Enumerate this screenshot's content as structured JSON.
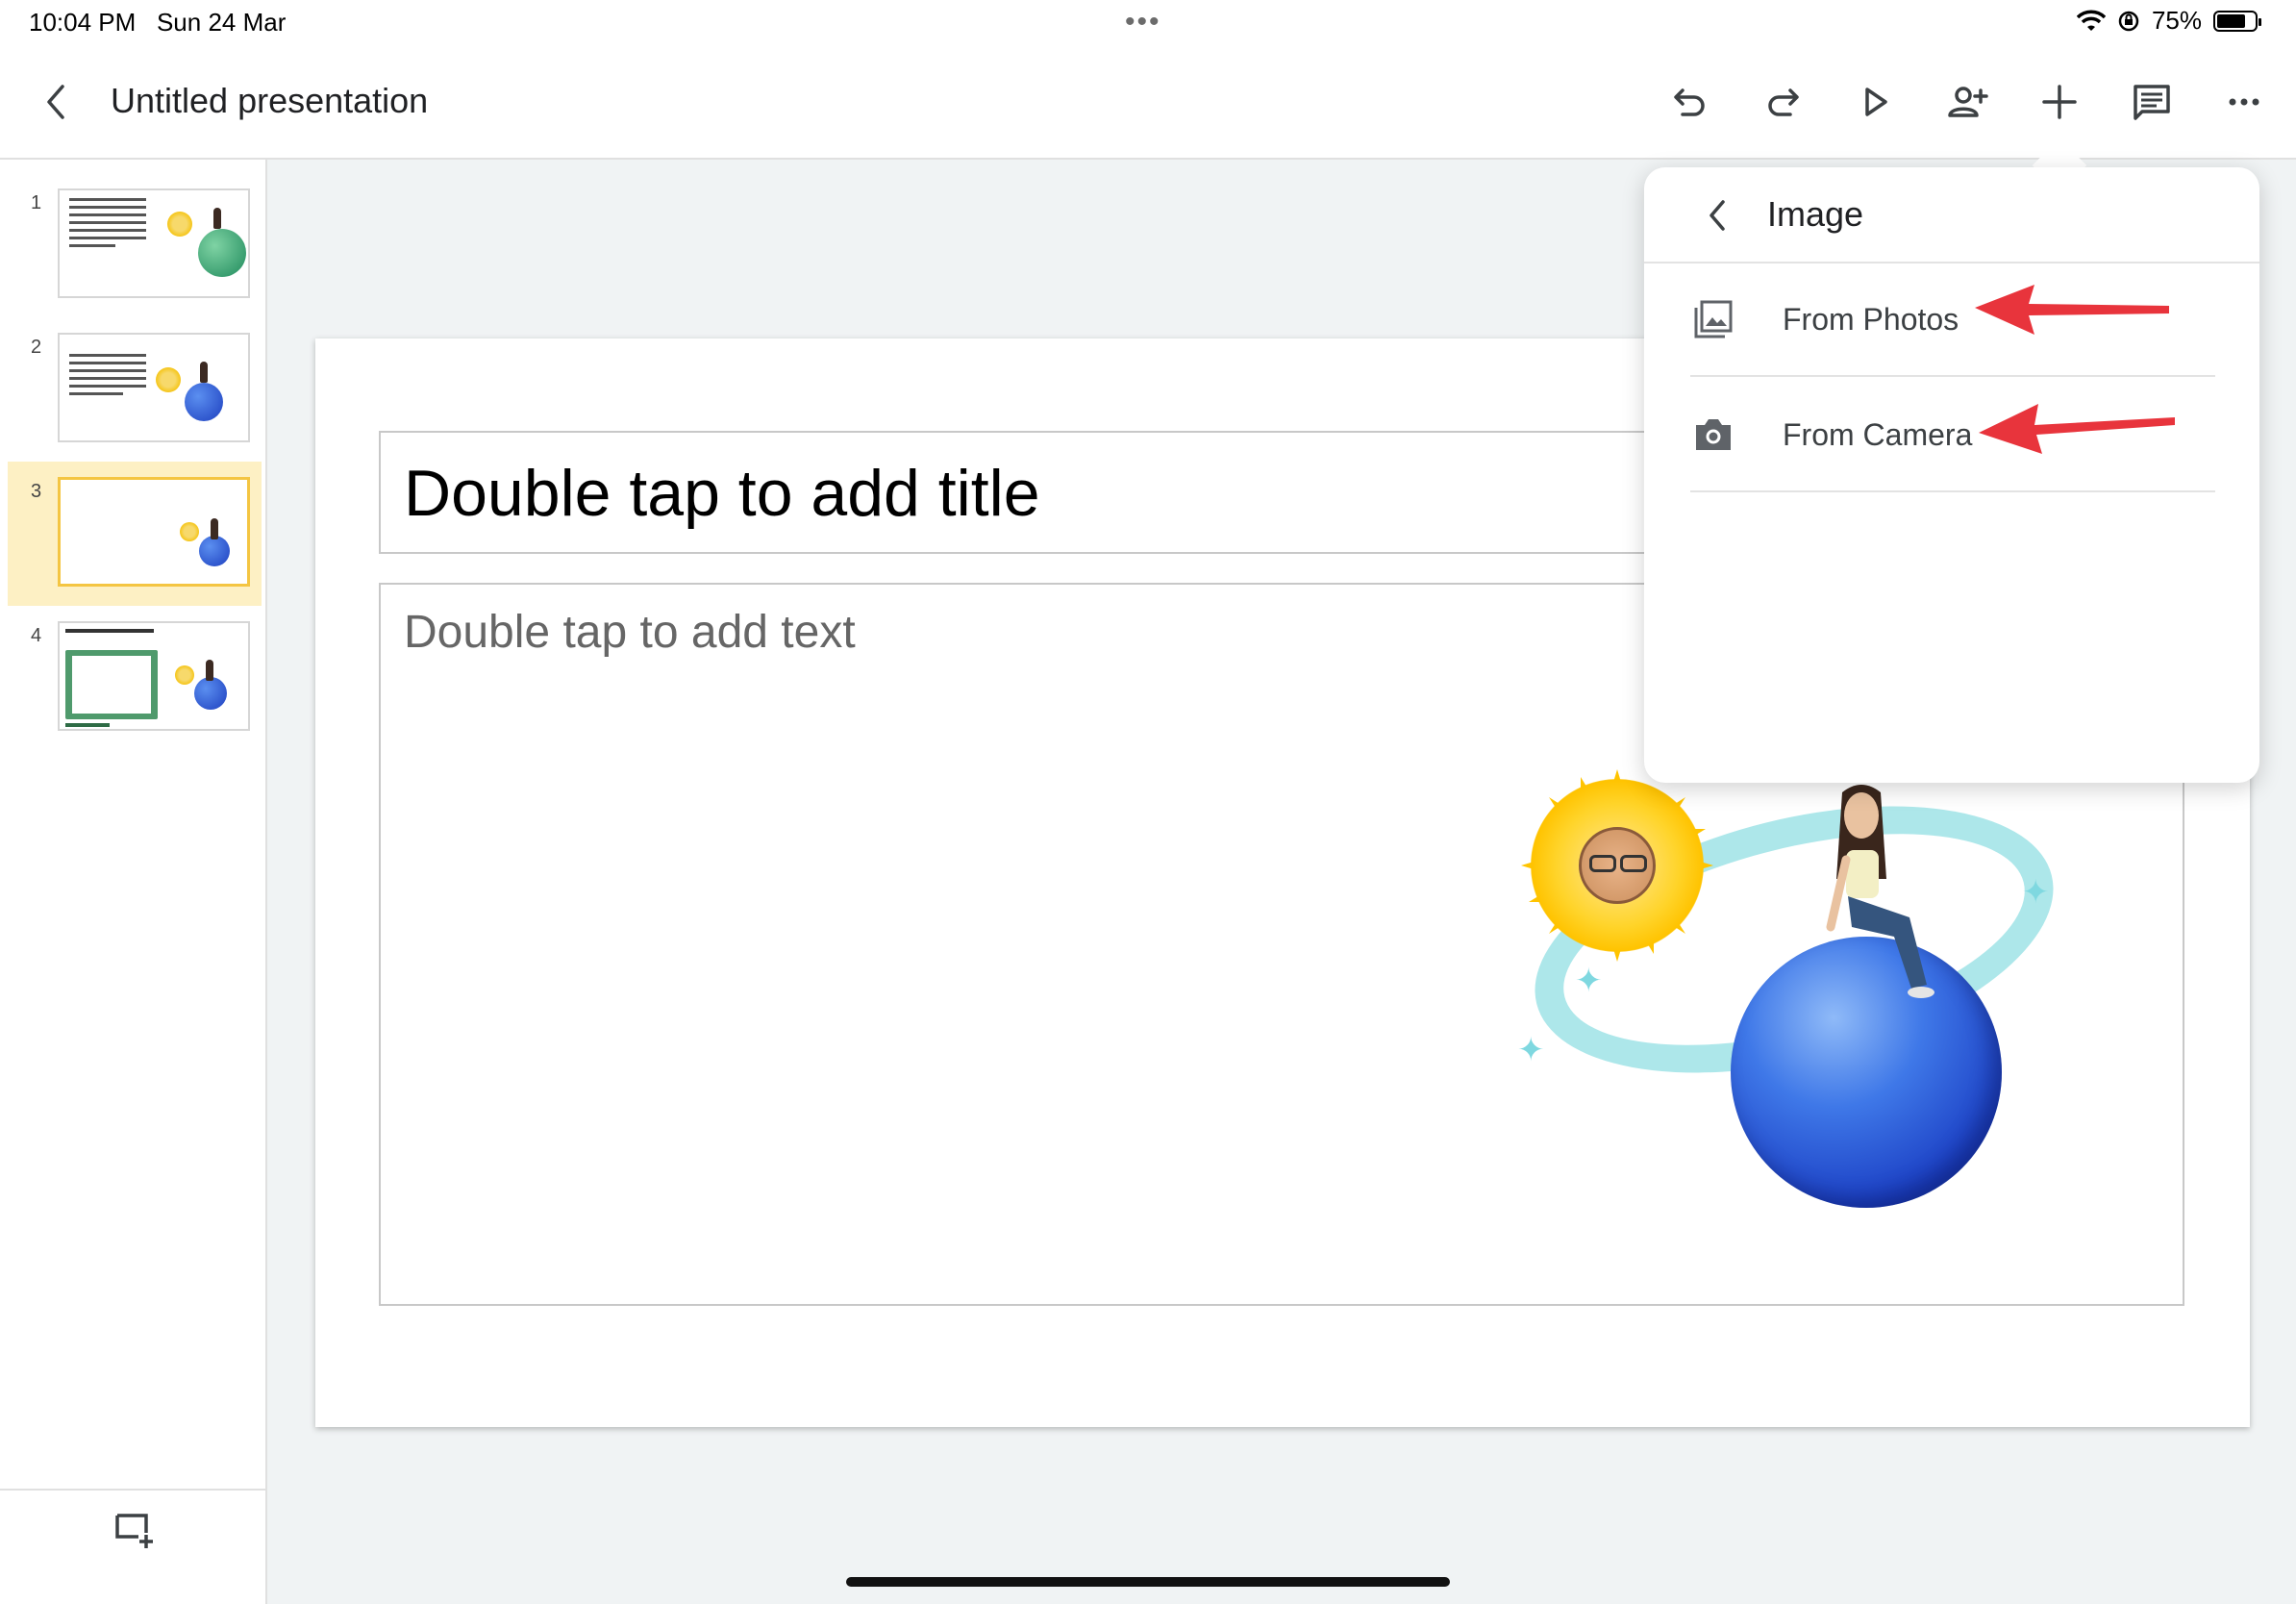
{
  "status_bar": {
    "time": "10:04 PM",
    "date": "Sun 24 Mar",
    "battery": "75%",
    "battery_level": 0.75
  },
  "header": {
    "title": "Untitled presentation",
    "toolbar": [
      "undo-icon",
      "redo-icon",
      "play-icon",
      "add-person-icon",
      "plus-icon",
      "comment-icon",
      "more-icon"
    ]
  },
  "sidebar": {
    "slides": [
      {
        "number": "1"
      },
      {
        "number": "2"
      },
      {
        "number": "3",
        "selected": true
      },
      {
        "number": "4"
      }
    ]
  },
  "slide": {
    "title_placeholder": "Double tap to add title",
    "body_placeholder": "Double tap to add text"
  },
  "popover": {
    "title": "Image",
    "items": [
      {
        "label": "From Photos",
        "icon": "photos-icon"
      },
      {
        "label": "From Camera",
        "icon": "camera-icon"
      }
    ]
  },
  "colors": {
    "accent": "#f4c542",
    "selected_row": "#fdf0c4",
    "annotation_arrow": "#e8343c"
  }
}
